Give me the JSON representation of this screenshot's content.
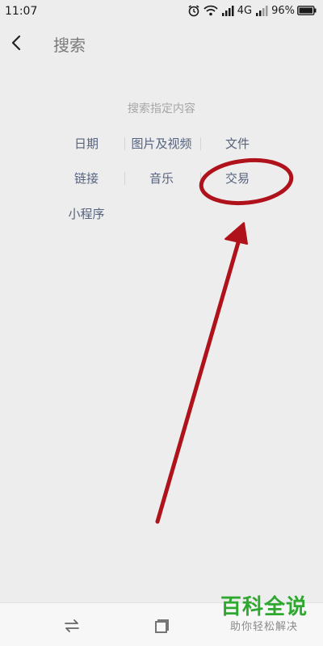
{
  "status_bar": {
    "time": "11:07",
    "network": "4G",
    "battery": "96%"
  },
  "header": {
    "title": "搜索"
  },
  "content": {
    "hint": "搜索指定内容",
    "categories": [
      {
        "label": "日期"
      },
      {
        "label": "图片及视频"
      },
      {
        "label": "文件"
      },
      {
        "label": "链接"
      },
      {
        "label": "音乐"
      },
      {
        "label": "交易"
      },
      {
        "label": "小程序"
      }
    ]
  },
  "watermark": {
    "main": "百科全说",
    "sub": "助你轻松解决"
  },
  "icons": {
    "back": "back-arrow-icon",
    "alarm": "alarm-icon",
    "wifi": "wifi-icon",
    "signal": "signal-icon",
    "battery": "battery-icon",
    "nav_back": "swap-arrows-icon",
    "nav_home": "square-icon"
  },
  "colors": {
    "background": "#ededed",
    "category_text": "#56637e",
    "annotation": "#b0121b",
    "watermark": "#2fa82f"
  }
}
